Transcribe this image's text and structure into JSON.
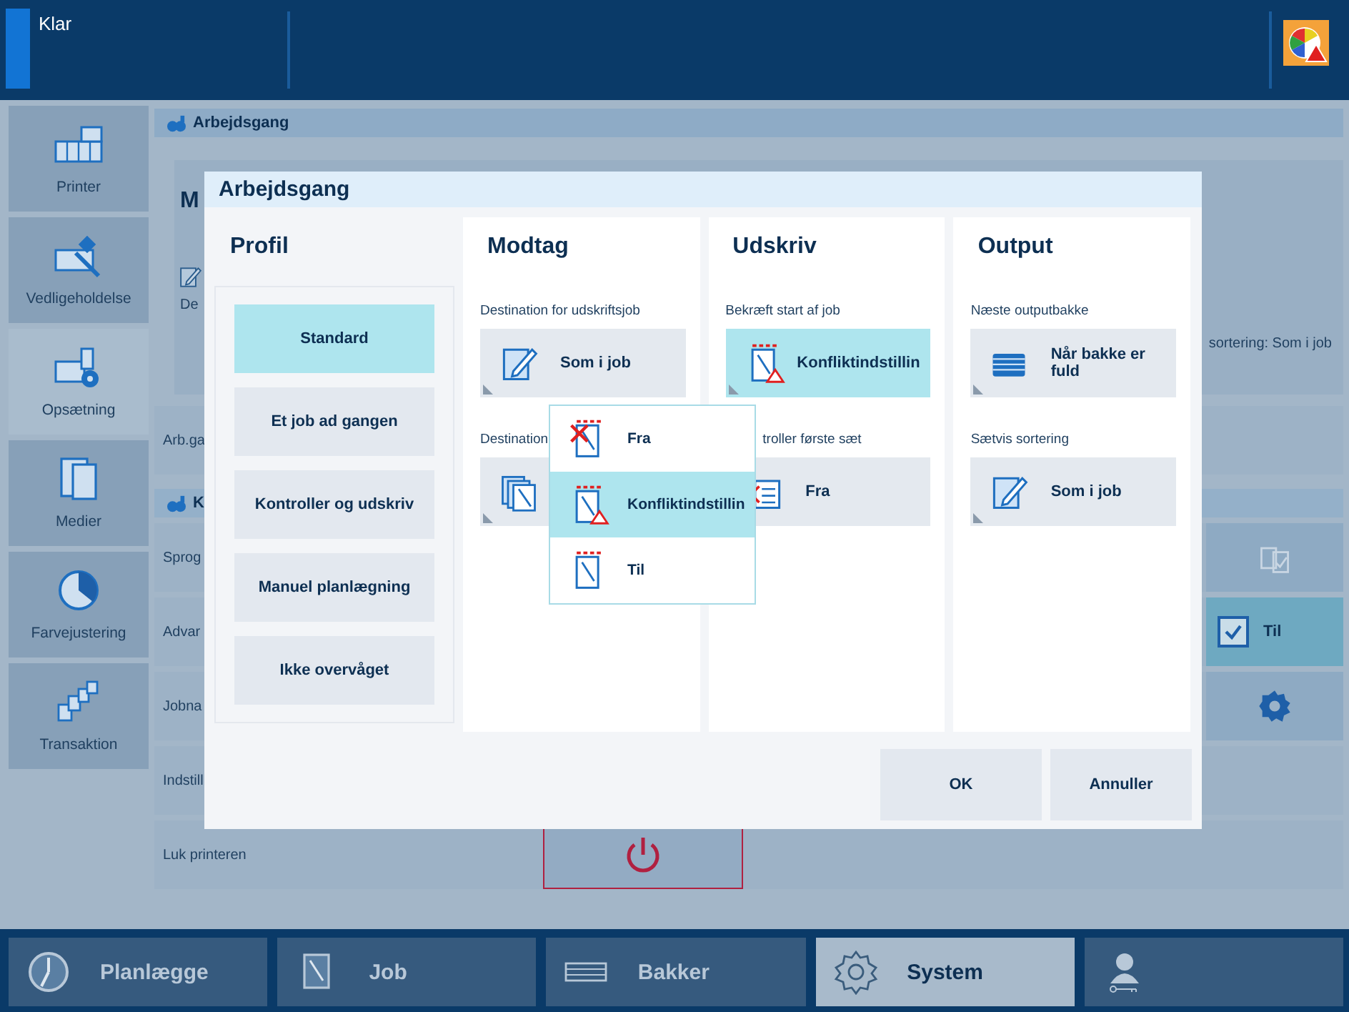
{
  "status_bar": {
    "status": "Klar"
  },
  "sidebar": {
    "items": [
      {
        "label": "Printer",
        "selected": false
      },
      {
        "label": "Vedligeholdelse",
        "selected": false
      },
      {
        "label": "Opsætning",
        "selected": true
      },
      {
        "label": "Medier",
        "selected": false
      },
      {
        "label": "Farvejustering",
        "selected": false
      },
      {
        "label": "Transaktion",
        "selected": false
      }
    ]
  },
  "background": {
    "section_header": "Arbejdsgang",
    "panel_heading": "M",
    "panel_label": "De",
    "panel_right_text": "sortering: Som i job",
    "row_label": "Arb.ga",
    "section_2_header": "K",
    "settings_rows": [
      {
        "label": "Sprog",
        "kind": "document"
      },
      {
        "label": "Advar",
        "kind": "checkbox",
        "checked": true,
        "value": "Til"
      },
      {
        "label": "Jobna",
        "kind": "gear"
      },
      {
        "label": "Indstill",
        "kind": "plain"
      },
      {
        "label": "Luk printeren",
        "kind": "power"
      }
    ]
  },
  "dialog": {
    "title": "Arbejdsgang",
    "profile": {
      "heading": "Profil",
      "options": [
        {
          "label": "Standard",
          "selected": true
        },
        {
          "label": "Et job ad gangen",
          "selected": false
        },
        {
          "label": "Kontroller og udskriv",
          "selected": false
        },
        {
          "label": "Manuel planlægning",
          "selected": false
        },
        {
          "label": "Ikke overvåget",
          "selected": false
        }
      ]
    },
    "columns": [
      {
        "heading": "Modtag",
        "settings": [
          {
            "label": "Destination for udskriftsjob",
            "value": "Som i job",
            "open": false,
            "covered": false
          },
          {
            "label": "Destination",
            "open": false,
            "covered": false
          }
        ]
      },
      {
        "heading": "Udskriv",
        "settings": [
          {
            "label": "Bekræft start af job",
            "value": "Konfliktindstillin",
            "open": true,
            "covered": false
          },
          {
            "label": "troller første sæt",
            "value": "Fra",
            "open": false,
            "covered": true
          }
        ]
      },
      {
        "heading": "Output",
        "settings": [
          {
            "label": "Næste outputbakke",
            "value": "Når bakke er fuld",
            "open": false,
            "covered": false
          },
          {
            "label": "Sætvis sortering",
            "value": "Som i job",
            "open": false,
            "covered": false
          }
        ]
      }
    ],
    "dropdown": {
      "options": [
        {
          "label": "Fra",
          "selected": false
        },
        {
          "label": "Konfliktindstillin",
          "selected": true
        },
        {
          "label": "Til",
          "selected": false
        }
      ]
    },
    "buttons": [
      "OK",
      "Annuller"
    ]
  },
  "bottom_tabs": [
    {
      "label": "Planlægge",
      "selected": false
    },
    {
      "label": "Job",
      "selected": false
    },
    {
      "label": "Bakker",
      "selected": false
    },
    {
      "label": "System",
      "selected": true
    },
    {
      "selected": false
    }
  ]
}
